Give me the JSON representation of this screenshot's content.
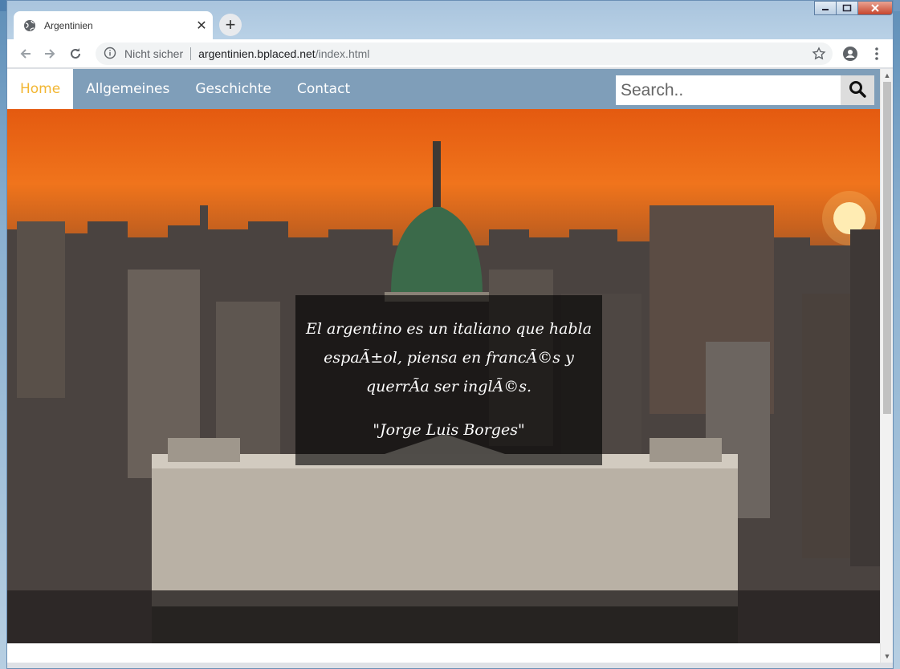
{
  "browser": {
    "tab_title": "Argentinien",
    "tab_close": "✕",
    "new_tab": "+",
    "insecure_label": "Nicht sicher",
    "url_host": "argentinien.bplaced.net",
    "url_path": "/index.html"
  },
  "site": {
    "nav": {
      "home": "Home",
      "allgemeines": "Allgemeines",
      "geschichte": "Geschichte",
      "contact": "Contact"
    },
    "search": {
      "placeholder": "Search.."
    },
    "quote": {
      "line1": "El argentino es un italiano que habla",
      "line2": "espaÃ±ol, piensa en francÃ©s y",
      "line3": "querrÃa ser inglÃ©s.",
      "author": "\"Jorge Luis Borges\""
    }
  },
  "colors": {
    "nav_bg": "#7f9eb9",
    "nav_active_text": "#f2b632"
  }
}
